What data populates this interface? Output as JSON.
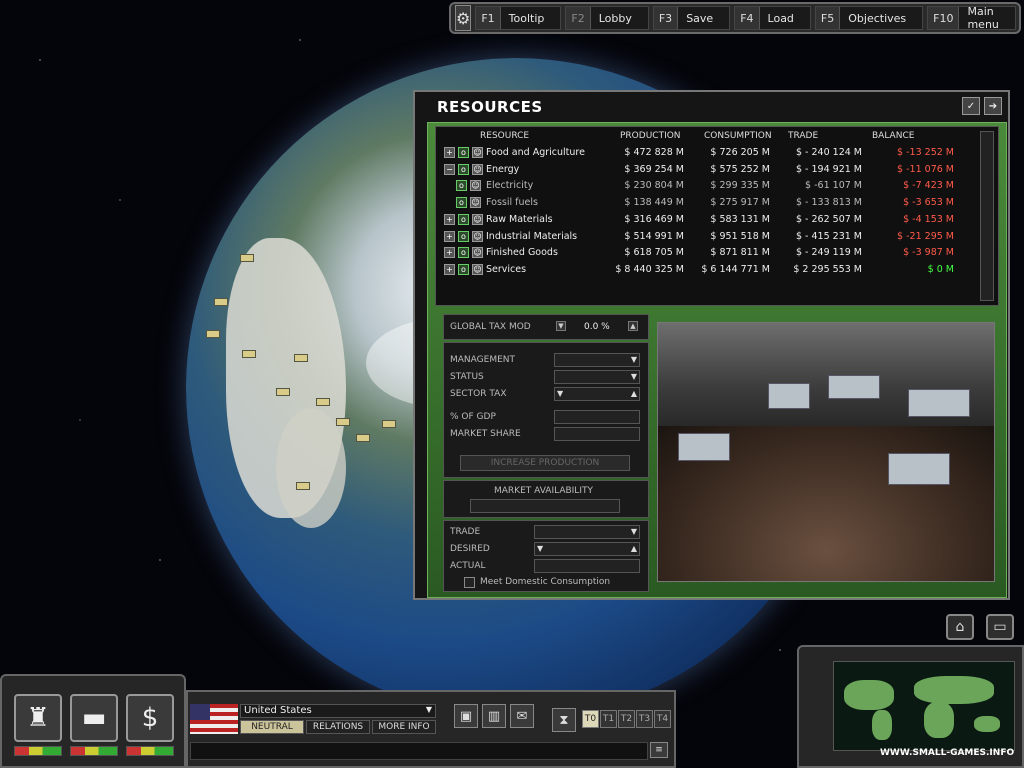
{
  "topbar": {
    "items": [
      {
        "key": "F1",
        "label": "Tooltip"
      },
      {
        "key": "F2",
        "label": "Lobby"
      },
      {
        "key": "F3",
        "label": "Save"
      },
      {
        "key": "F4",
        "label": "Load"
      },
      {
        "key": "F5",
        "label": "Objectives"
      },
      {
        "key": "F10",
        "label": "Main menu"
      }
    ]
  },
  "resources": {
    "title": "RESOURCES",
    "headers": {
      "resource": "RESOURCE",
      "production": "PRODUCTION",
      "consumption": "CONSUMPTION",
      "trade": "TRADE",
      "balance": "BALANCE"
    },
    "rows": [
      {
        "name": "Food and Agriculture",
        "production": "$ 472 828 M",
        "consumption": "$ 726 205 M",
        "trade": "$ - 240 124 M",
        "balance": "$ -13 252 M",
        "balance_status": "negative"
      },
      {
        "name": "Energy",
        "production": "$ 369 254 M",
        "consumption": "$ 575 252 M",
        "trade": "$ - 194 921 M",
        "balance": "$ -11 076 M",
        "balance_status": "negative"
      },
      {
        "name": "Electricity",
        "production": "$ 230 804 M",
        "consumption": "$ 299 335 M",
        "trade": "$ -61 107 M",
        "balance": "$ -7 423 M",
        "balance_status": "negative"
      },
      {
        "name": "Fossil fuels",
        "production": "$ 138 449 M",
        "consumption": "$ 275 917 M",
        "trade": "$ - 133 813 M",
        "balance": "$ -3 653 M",
        "balance_status": "negative"
      },
      {
        "name": "Raw Materials",
        "production": "$ 316 469 M",
        "consumption": "$ 583 131 M",
        "trade": "$ - 262 507 M",
        "balance": "$ -4 153 M",
        "balance_status": "negative"
      },
      {
        "name": "Industrial Materials",
        "production": "$ 514 991 M",
        "consumption": "$ 951 518 M",
        "trade": "$ - 415 231 M",
        "balance": "$ -21 295 M",
        "balance_status": "negative"
      },
      {
        "name": "Finished Goods",
        "production": "$ 618 705 M",
        "consumption": "$ 871 811 M",
        "trade": "$ - 249 119 M",
        "balance": "$ -3 987 M",
        "balance_status": "negative"
      },
      {
        "name": "Services",
        "production": "$ 8 440 325 M",
        "consumption": "$ 6 144 771 M",
        "trade": "$ 2 295 553 M",
        "balance": "$ 0 M",
        "balance_status": "zero"
      }
    ],
    "global_tax_label": "GLOBAL TAX MOD",
    "global_tax_value": "0.0 %",
    "management_label": "MANAGEMENT",
    "status_label": "STATUS",
    "sector_tax_label": "SECTOR TAX",
    "pct_gdp_label": "% OF GDP",
    "market_share_label": "MARKET SHARE",
    "increase_production_label": "INCREASE PRODUCTION",
    "market_availability_label": "MARKET AVAILABILITY",
    "trade_label": "TRADE",
    "desired_label": "DESIRED",
    "actual_label": "ACTUAL",
    "meet_domestic_label": "Meet Domestic Consumption"
  },
  "hud": {
    "country": "United States",
    "relations": {
      "neutral": "NEUTRAL",
      "relations": "RELATIONS",
      "more_info": "MORE INFO"
    },
    "time_buttons": [
      "T0",
      "T1",
      "T2",
      "T3",
      "T4"
    ],
    "active_time": "T0",
    "dollar_icon": "$"
  },
  "watermark": "WWW.SMALL-GAMES.INFO",
  "colors": {
    "negative": "#ff5a4a",
    "zero": "#44ff44",
    "frame_green": "#4a8a3a"
  }
}
